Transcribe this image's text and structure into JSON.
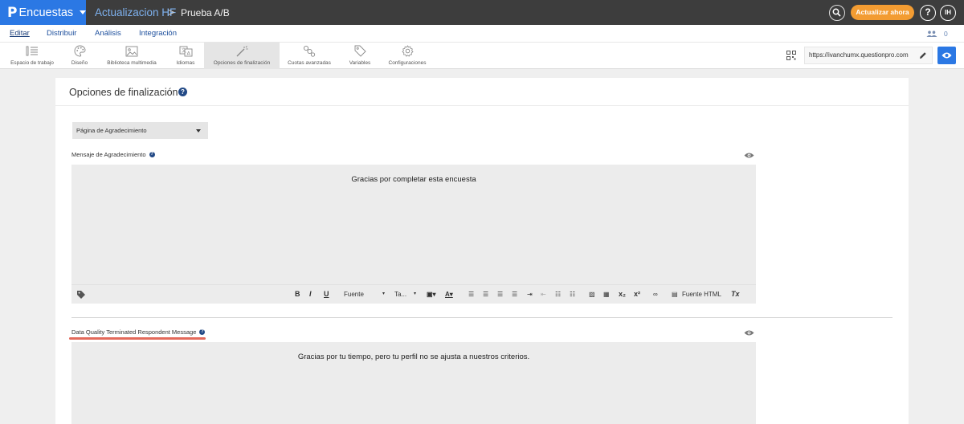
{
  "topbar": {
    "brand_logo": "P",
    "brand_name": "Encuestas",
    "breadcrumb_survey": "Actualizacion HF",
    "breadcrumb_sep": ">",
    "breadcrumb_page": "Prueba A/B",
    "upgrade_label": "Actualizar ahora",
    "help_label": "?",
    "avatar_initials": "IH",
    "colors": {
      "bar": "#3d3d3d",
      "brand": "#2b78e4",
      "upgrade": "#f39c32"
    }
  },
  "menu": {
    "items": [
      {
        "label": "Editar",
        "active": true
      },
      {
        "label": "Distribuir"
      },
      {
        "label": "Análisis"
      },
      {
        "label": "Integración"
      }
    ],
    "collaborators_count": "0",
    "collaborators_icon": "users-icon"
  },
  "toolbar": {
    "tools": [
      {
        "label": "Espacio de trabajo",
        "icon": "workspace-list-icon"
      },
      {
        "label": "Diseño",
        "icon": "palette-icon"
      },
      {
        "label": "Biblioteca multimedia",
        "icon": "image-icon"
      },
      {
        "label": "Idiomas",
        "icon": "translate-icon"
      },
      {
        "label": "Opciones de finalización",
        "icon": "magic-wand-icon",
        "selected": true
      },
      {
        "label": "Cuotas avanzadas",
        "icon": "quota-icon"
      },
      {
        "label": "Variables",
        "icon": "tag-icon"
      },
      {
        "label": "Configuraciones",
        "icon": "gear-icon"
      }
    ],
    "survey_url": "https://ivanchumx.questionpro.com"
  },
  "main": {
    "title": "Opciones de finalización",
    "end_page_select": "Página de Agradecimiento",
    "thanks_label": "Mensaje de Agradecimiento",
    "thanks_message": "Gracias por completar esta encuesta",
    "dq_label": "Data Quality Terminated Respondent Message",
    "dq_message": "Gracias por tu tiempo, pero tu perfil no se ajusta a nuestros criterios.",
    "editor_toolbar": {
      "bold": "B",
      "italic": "I",
      "underline": "U",
      "font": "Fuente",
      "size": "Ta...",
      "subscript": "x₂",
      "superscript": "x²",
      "source": "Fuente HTML",
      "clear": "Tx"
    }
  }
}
